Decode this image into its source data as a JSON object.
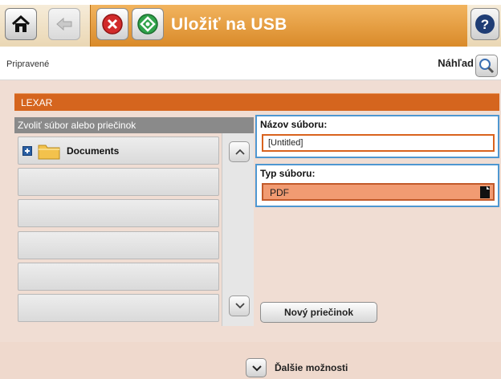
{
  "header": {
    "title": "Uložiť na USB",
    "accent_color": "#e0962f",
    "buttons": [
      {
        "icon": "home-icon"
      },
      {
        "icon": "back-icon"
      },
      {
        "icon": "stop-icon"
      },
      {
        "icon": "start-icon"
      },
      {
        "icon": "help-icon",
        "glyph": "?"
      }
    ]
  },
  "status": {
    "text": "Pripravené",
    "preview_label": "Náhľad",
    "preview_icon": "magnifier-icon"
  },
  "device": {
    "name": "LEXAR",
    "color": "#d5651e"
  },
  "file_browser": {
    "header": "Zvoliť súbor alebo priečinok",
    "items": [
      {
        "label": "Documents",
        "icon": "folder-icon",
        "expander": "expand-icon"
      },
      {
        "label": ""
      },
      {
        "label": ""
      },
      {
        "label": ""
      },
      {
        "label": ""
      },
      {
        "label": ""
      }
    ],
    "scroll_up_icon": "chevron-up-icon",
    "scroll_down_icon": "chevron-down-icon"
  },
  "file_name": {
    "label": "Názov súboru:",
    "value": "[Untitled]"
  },
  "file_type": {
    "label": "Typ súboru:",
    "value": "PDF",
    "icon": "document-icon"
  },
  "buttons": {
    "new_folder": "Nový priečinok",
    "more_options": "Ďalšie možnosti"
  }
}
